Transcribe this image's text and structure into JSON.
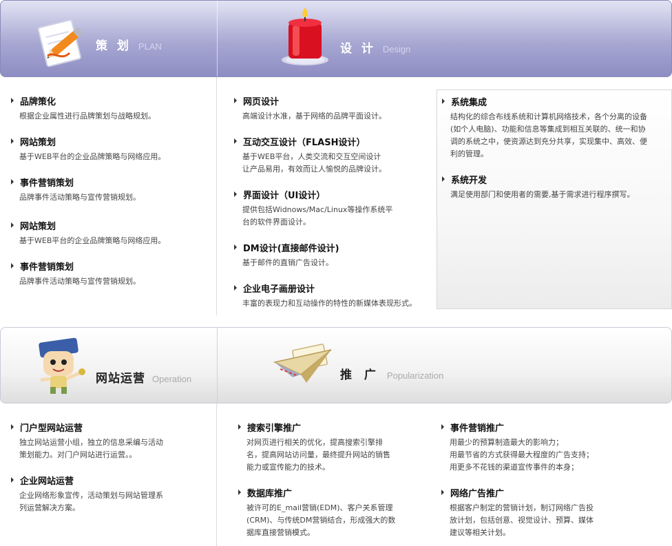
{
  "sections": {
    "plan": {
      "title": "策 划",
      "subtitle": "PLAN"
    },
    "design": {
      "title": "设 计",
      "subtitle": "Design"
    },
    "operation": {
      "title": "网站运营",
      "subtitle": "Operation"
    },
    "promotion": {
      "title": "推 广",
      "subtitle": "Popularization"
    }
  },
  "plan_items": [
    {
      "title": "品牌策化",
      "desc": "根据企业属性进行品牌策划与战略规划。"
    },
    {
      "title": "网站策划",
      "desc": "基于WEB平台的企业品牌策略与网络应用。"
    },
    {
      "title": "事件营销策划",
      "desc": "品牌事件活动策略与宣传营销规划。"
    },
    {
      "title": "网站策划",
      "desc": "基于WEB平台的企业品牌策略与网络应用。"
    },
    {
      "title": "事件营销策划",
      "desc": "品牌事件活动策略与宣传营销规划。"
    }
  ],
  "design_items": [
    {
      "title": "网页设计",
      "desc": "高端设计水准，基于网络的品牌平面设计。"
    },
    {
      "title": "互动交互设计（FLASH设计）",
      "desc": "基于WEB平台，人类交流和交互空间设计\n让产品易用，有效而让人愉悦的品牌设计。"
    },
    {
      "title": "界面设计（UI设计）",
      "desc": "提供包括Widnows/Mac/Linux等操作系统平\n台的软件界面设计。"
    },
    {
      "title": "DM设计(直接邮件设计)",
      "desc": "基于邮件的直销广告设计。"
    },
    {
      "title": "企业电子画册设计",
      "desc": "丰富的表现力和互动操作的特性的新媒体表现形式。"
    }
  ],
  "system_items": [
    {
      "title": "系统集成",
      "desc": "结构化的综合布线系统和计算机网络技术，各个分离的设备\n(如个人电脑)、功能和信息等集成到相互关联的、统一和协\n调的系统之中，使资源达到充分共享，实现集中、高效、便\n利的管理。"
    },
    {
      "title": "系统开发",
      "desc": "满足使用部门和使用者的需要,基于需求进行程序撰写。"
    }
  ],
  "operation_items": [
    {
      "title": "门户型网站运营",
      "desc": "独立网站运营小组，独立的信息采编与活动\n策划能力。对门户网站进行运营。。"
    },
    {
      "title": "企业网站运营",
      "desc": "企业网络形象宣传，活动策划与网站管理系\n列运营解决方案。"
    }
  ],
  "promo_items_left": [
    {
      "title": "搜索引擎推广",
      "desc": "对网页进行相关的优化，提高搜索引擎排\n名，提高网站访问量，最终提升网站的销售\n能力或宣传能力的技术。"
    },
    {
      "title": "数据库推广",
      "desc": "被许可的E_mail营销(EDM)、客户关系管理\n(CRM)、与传统DM营销结合，形成强大的数\n据库直接营销模式。"
    }
  ],
  "promo_items_right": [
    {
      "title": "事件营销推广",
      "desc": "用最少的预算制造最大的影响力；\n用最节省的方式获得最大程度的广告支持；\n用更多不花钱的渠道宣传事件的本身；"
    },
    {
      "title": "网络广告推广",
      "desc": "根据客户制定的营销计划，制订网络广告投\n放计划，包括创意、视觉设计、预算、媒体\n建议等相关计划。"
    }
  ],
  "icons": {
    "plan": "pencil-paper-icon",
    "design": "red-candle-icon",
    "operation": "cartoon-character-icon",
    "promotion": "paper-plane-envelope-icon"
  }
}
